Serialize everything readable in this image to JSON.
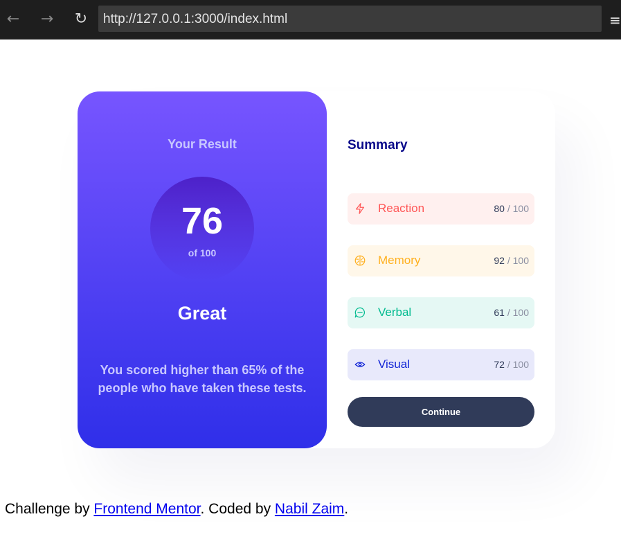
{
  "browser": {
    "url": "http://127.0.0.1:3000/index.html"
  },
  "result": {
    "title": "Your Result",
    "score": "76",
    "score_of": "of 100",
    "grade": "Great",
    "description": "You scored higher than 65% of the people who have taken these tests."
  },
  "summary": {
    "title": "Summary",
    "items": [
      {
        "label": "Reaction",
        "score": "80",
        "max": "/ 100",
        "icon": "lightning-icon",
        "color": "#ff5757",
        "bg": "#fff0ef"
      },
      {
        "label": "Memory",
        "score": "92",
        "max": "/ 100",
        "icon": "brain-icon",
        "color": "#ffb01f",
        "bg": "#fff7e9"
      },
      {
        "label": "Verbal",
        "score": "61",
        "max": "/ 100",
        "icon": "chat-bubble-icon",
        "color": "#00bb8f",
        "bg": "#e5f8f4"
      },
      {
        "label": "Visual",
        "score": "72",
        "max": "/ 100",
        "icon": "eye-icon",
        "color": "#1125d6",
        "bg": "#e8e9fb"
      }
    ],
    "continue_label": "Continue"
  },
  "footer": {
    "prefix": "Challenge by ",
    "link1": "Frontend Mentor",
    "middle": ". Coded by ",
    "link2": "Nabil Zaim",
    "suffix": "."
  }
}
